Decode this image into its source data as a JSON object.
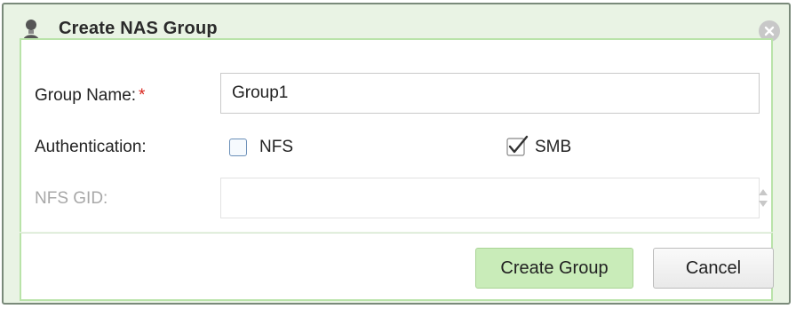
{
  "dialog": {
    "title": "Create NAS Group"
  },
  "form": {
    "group_name_label": "Group Name:",
    "required_mark": "*",
    "group_name_value": "Group1",
    "authentication_label": "Authentication:",
    "nfs_label": "NFS",
    "nfs_checked": false,
    "smb_label": "SMB",
    "smb_checked": true,
    "nfs_gid_label": "NFS GID:",
    "nfs_gid_value": ""
  },
  "footer": {
    "create_label": "Create Group",
    "cancel_label": "Cancel"
  },
  "colors": {
    "accent_green": "#c9ecb9",
    "required_red": "#d9251c"
  },
  "icons": {
    "title": "user-icon",
    "close": "close-icon",
    "checkmark": "checkmark-icon",
    "spinner": "spinner-arrows-icon"
  }
}
